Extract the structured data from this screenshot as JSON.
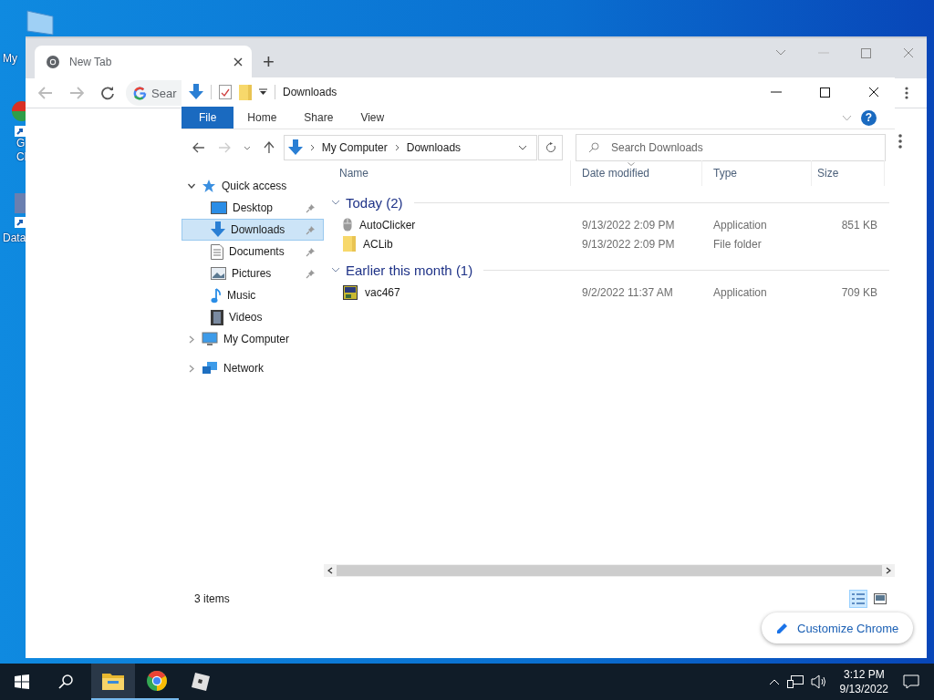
{
  "desktop": {
    "icons": [
      {
        "kind": "computer",
        "lines": [
          "My"
        ]
      },
      {
        "kind": "chrome",
        "lines": [
          "G",
          "Cl"
        ]
      },
      {
        "kind": "data",
        "lines": [
          "Data"
        ]
      }
    ]
  },
  "browser": {
    "tab": {
      "title": "New Tab",
      "selected": true
    },
    "new_tab": "+",
    "omnibox": {
      "placeholder": "Sear"
    },
    "customize_button": "Customize Chrome"
  },
  "explorer": {
    "title": "Downloads",
    "ribbon_tabs": [
      {
        "label": "File",
        "selected": true
      },
      {
        "label": "Home",
        "selected": false
      },
      {
        "label": "Share",
        "selected": false
      },
      {
        "label": "View",
        "selected": false
      }
    ],
    "help": "?",
    "address": [
      "My Computer",
      "Downloads"
    ],
    "search": {
      "placeholder": "Search Downloads"
    },
    "nav": [
      {
        "label": "Quick access",
        "kind": "star",
        "expanded": true,
        "selected": false,
        "children": [
          {
            "label": "Desktop",
            "kind": "desktop",
            "pinned": true,
            "selected": false
          },
          {
            "label": "Downloads",
            "kind": "download",
            "pinned": true,
            "selected": true
          },
          {
            "label": "Documents",
            "kind": "document",
            "pinned": true,
            "selected": false
          },
          {
            "label": "Pictures",
            "kind": "picture",
            "pinned": true,
            "selected": false
          },
          {
            "label": "Music",
            "kind": "music",
            "pinned": false,
            "selected": false
          },
          {
            "label": "Videos",
            "kind": "video",
            "pinned": false,
            "selected": false
          }
        ]
      },
      {
        "label": "My Computer",
        "kind": "computer",
        "expanded": false,
        "selected": false
      },
      {
        "label": "Network",
        "kind": "network",
        "expanded": false,
        "selected": false
      }
    ],
    "columns": [
      "Name",
      "Date modified",
      "Type",
      "Size"
    ],
    "groups": [
      {
        "label": "Today (2)",
        "expanded": true,
        "rows": [
          {
            "name": "AutoClicker",
            "kind": "mouse",
            "date": "9/13/2022 2:09 PM",
            "type": "Application",
            "size": "851 KB"
          },
          {
            "name": "ACLib",
            "kind": "folder",
            "date": "9/13/2022 2:09 PM",
            "type": "File folder"
          }
        ]
      },
      {
        "label": "Earlier this month (1)",
        "expanded": true,
        "rows": [
          {
            "name": "vac467",
            "kind": "app",
            "date": "9/2/2022 11:37 AM",
            "type": "Application",
            "size": "709 KB"
          }
        ]
      }
    ],
    "status": "3 items",
    "views": [
      {
        "kind": "details",
        "selected": true
      },
      {
        "kind": "large",
        "selected": false
      }
    ]
  },
  "taskbar": {
    "apps": [
      {
        "kind": "explorer",
        "active": true,
        "running": true
      },
      {
        "kind": "chrome",
        "active": false,
        "running": true
      },
      {
        "kind": "cube",
        "active": false,
        "running": false
      }
    ],
    "time": "3:12 PM",
    "date": "9/13/2022"
  }
}
